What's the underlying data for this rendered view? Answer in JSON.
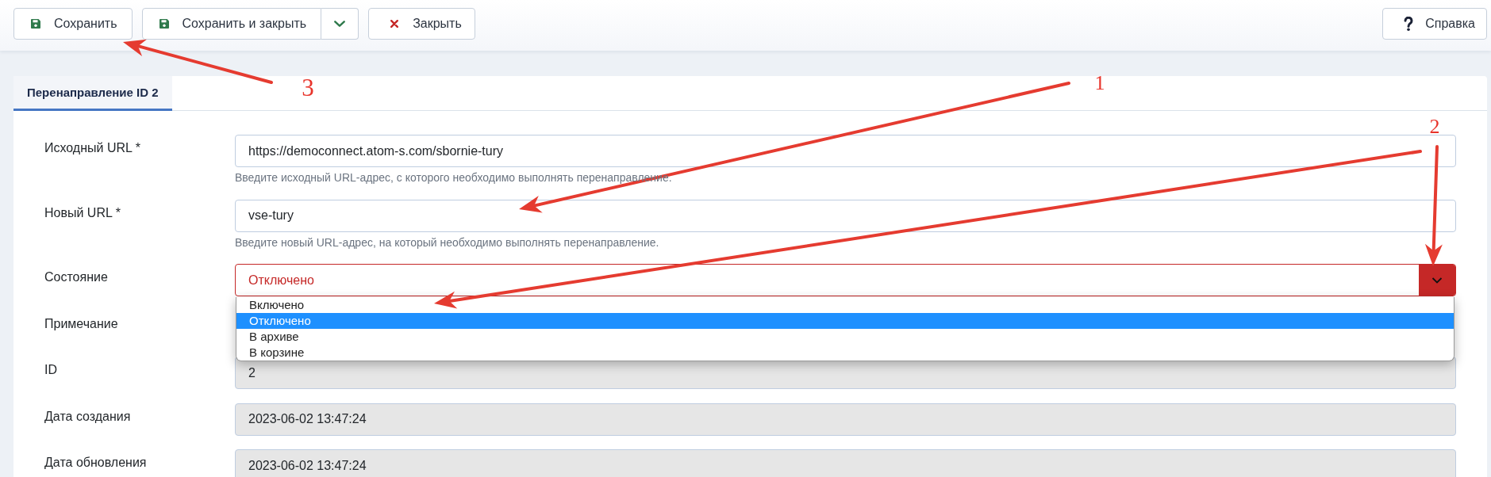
{
  "toolbar": {
    "buttons": [
      {
        "kind": "save",
        "label": "Сохранить"
      },
      {
        "kind": "save-split",
        "label": "Сохранить и закрыть"
      },
      {
        "kind": "close",
        "label": "Закрыть"
      },
      {
        "kind": "help",
        "label": "Справка"
      }
    ]
  },
  "tabs": [
    {
      "label": "Перенаправление ID 2",
      "selected": true
    }
  ],
  "form": {
    "fields": [
      {
        "kind": "text",
        "label": "Исходный URL *",
        "value": "https://democonnect.atom-s.com/sbornie-tury",
        "hint": "Введите исходный URL-адрес, с которого необходимо выполнять перенаправление.",
        "readonly": false
      },
      {
        "kind": "text",
        "label": "Новый URL *",
        "value": "vse-tury",
        "hint": "Введите новый URL-адрес, на который необходимо выполнять перенаправление.",
        "readonly": false
      },
      {
        "kind": "select",
        "label": "Состояние",
        "value": "Отключено",
        "expanded": true,
        "options": [
          {
            "label": "Включено",
            "selected": false
          },
          {
            "label": "Отключено",
            "selected": true
          },
          {
            "label": "В архиве",
            "selected": false
          },
          {
            "label": "В корзине",
            "selected": false
          }
        ]
      },
      {
        "kind": "covered",
        "label": "Примечание"
      },
      {
        "kind": "text",
        "label": "ID",
        "value": "2",
        "readonly": true
      },
      {
        "kind": "text",
        "label": "Дата создания",
        "value": "2023-06-02 13:47:24",
        "readonly": true
      },
      {
        "kind": "text",
        "label": "Дата обновления",
        "value": "2023-06-02 13:47:24",
        "readonly": true
      }
    ]
  },
  "annotations": [
    {
      "label": "3"
    },
    {
      "label": "1"
    },
    {
      "label": "2"
    }
  ]
}
